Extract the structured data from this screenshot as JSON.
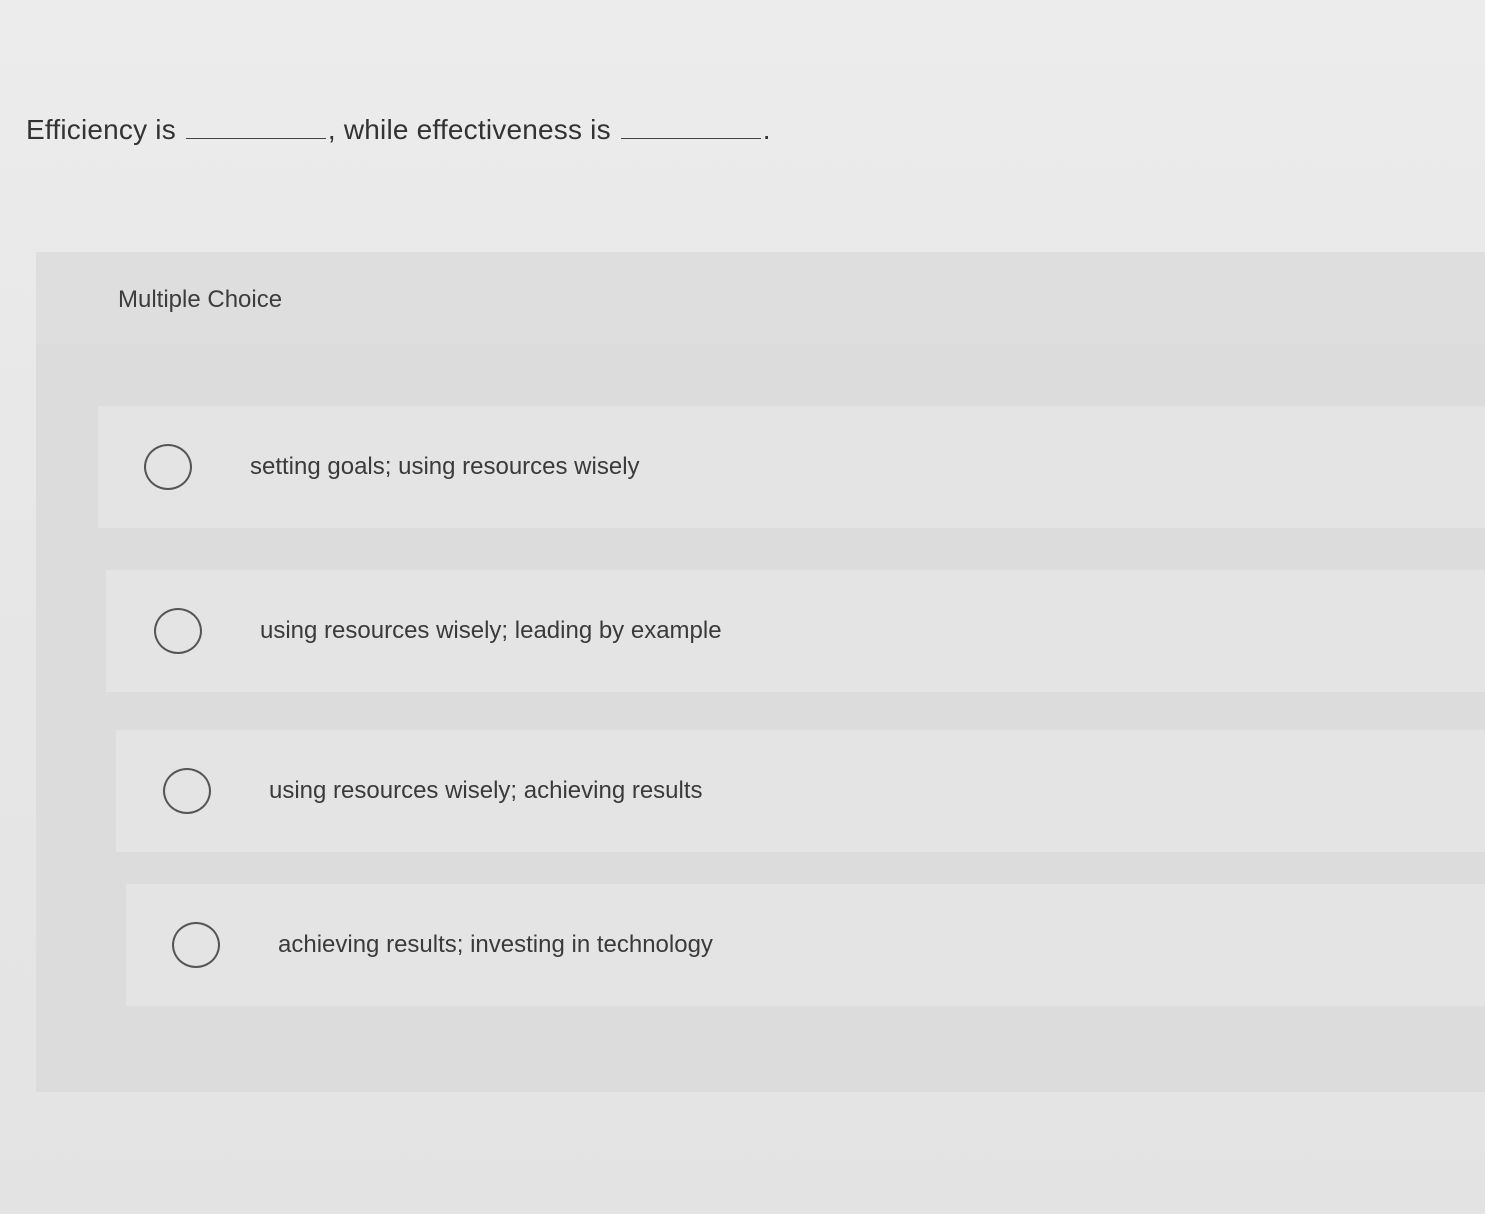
{
  "question": {
    "prefix": "Efficiency is",
    "middle": ", while effectiveness is",
    "suffix": "."
  },
  "multiple_choice": {
    "title": "Multiple Choice",
    "options": [
      {
        "label": "setting goals; using resources wisely",
        "selected": false
      },
      {
        "label": "using resources wisely; leading by example",
        "selected": false
      },
      {
        "label": "using resources wisely; achieving results",
        "selected": false
      },
      {
        "label": "achieving results; investing in technology",
        "selected": false
      }
    ]
  },
  "colors": {
    "background": "#e8e8e8",
    "panel": "#dcdcdc",
    "option_row": "#e4e4e4",
    "text": "#3a3a3a"
  }
}
